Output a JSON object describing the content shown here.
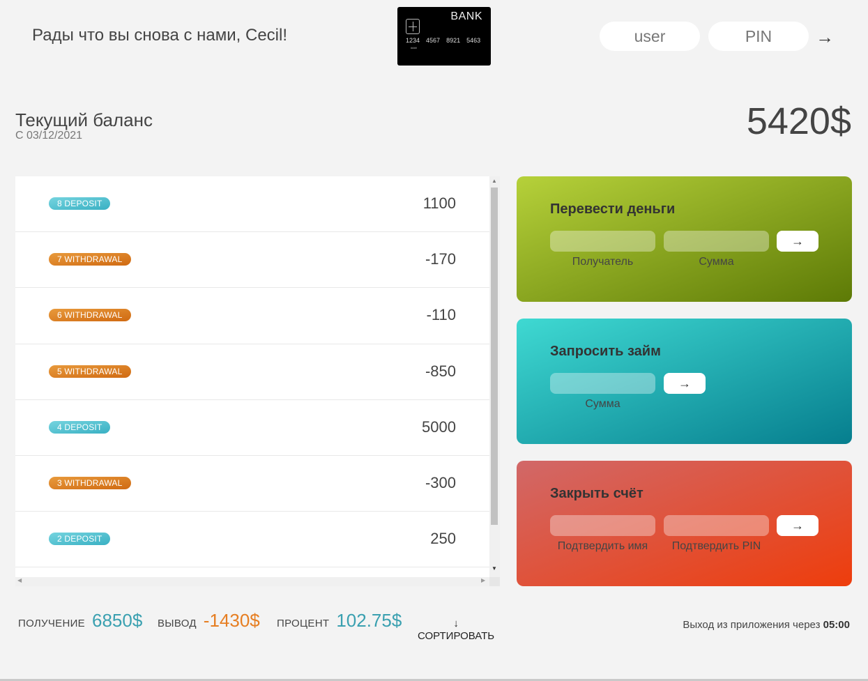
{
  "header": {
    "welcome": "Рады что вы снова с нами, Cecil!",
    "card": {
      "bank": "BANK",
      "numbers": [
        "1234",
        "4567",
        "8921",
        "5463"
      ],
      "sub": "####"
    },
    "login": {
      "user_placeholder": "user",
      "pin_placeholder": "PIN",
      "submit_icon": "→"
    }
  },
  "balance": {
    "label": "Текущий баланс",
    "date": "С 03/12/2021",
    "value": "5420$"
  },
  "movements": [
    {
      "tag": "8 DEPOSIT",
      "type": "deposit",
      "value": "1100"
    },
    {
      "tag": "7 WITHDRAWAL",
      "type": "withdrawal",
      "value": "-170"
    },
    {
      "tag": "6 WITHDRAWAL",
      "type": "withdrawal",
      "value": "-110"
    },
    {
      "tag": "5 WITHDRAWAL",
      "type": "withdrawal",
      "value": "-850"
    },
    {
      "tag": "4 DEPOSIT",
      "type": "deposit",
      "value": "5000"
    },
    {
      "tag": "3 WITHDRAWAL",
      "type": "withdrawal",
      "value": "-300"
    },
    {
      "tag": "2 DEPOSIT",
      "type": "deposit",
      "value": "250"
    }
  ],
  "operations": {
    "transfer": {
      "title": "Перевести деньги",
      "recipient_label": "Получатель",
      "amount_label": "Сумма",
      "button": "→"
    },
    "loan": {
      "title": "Запросить займ",
      "amount_label": "Сумма",
      "button": "→"
    },
    "close": {
      "title": "Закрыть счёт",
      "user_label": "Подтвердить имя",
      "pin_label": "Подтвердить PIN",
      "button": "→"
    }
  },
  "summary": {
    "in_label": "ПОЛУЧЕНИЕ",
    "in_value": "6850$",
    "out_label": "ВЫВОД",
    "out_value": "-1430$",
    "interest_label": "ПРОЦЕНТ",
    "interest_value": "102.75$",
    "sort_icon": "↓",
    "sort_label": "СОРТИРОВАТЬ"
  },
  "logout": {
    "text": "Выход из приложения через ",
    "time": "05:00"
  },
  "colors": {
    "deposit": "#39b0c3",
    "withdrawal": "#d06a12",
    "transfer_card": "#8fae1b",
    "loan_card": "#1aadb0",
    "close_card": "#e24f2e"
  }
}
